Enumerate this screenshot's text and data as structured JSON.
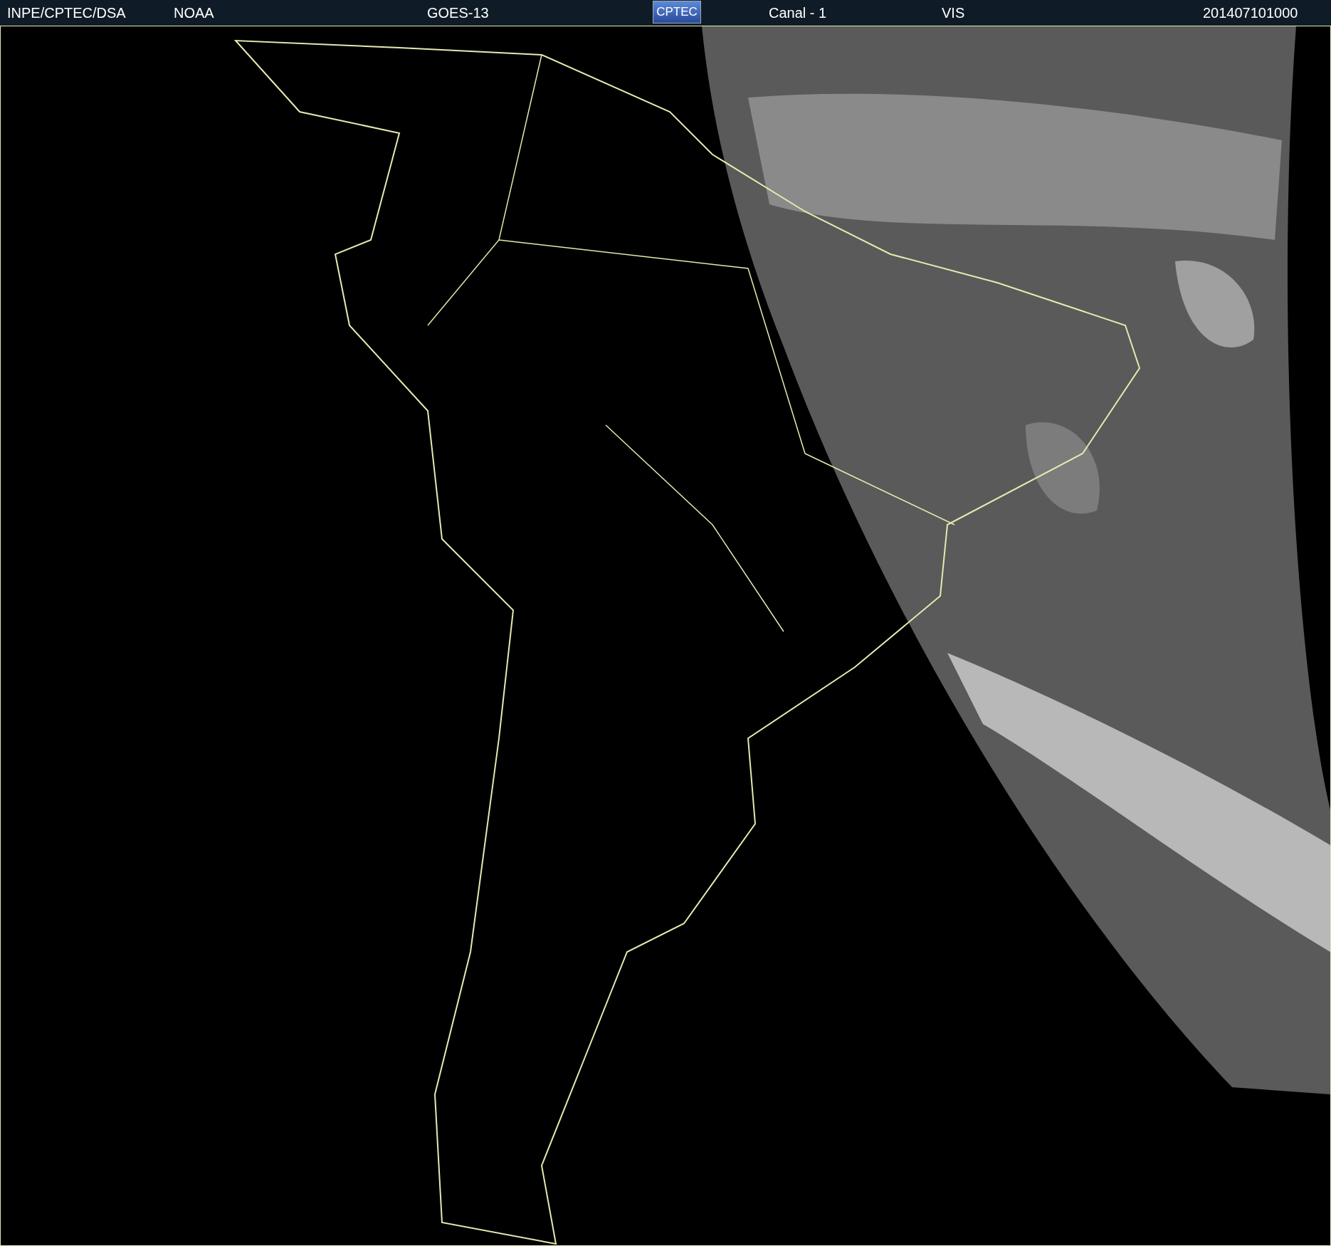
{
  "header": {
    "items": [
      {
        "kind": "text",
        "text": "INPE/CPTEC/DSA"
      },
      {
        "kind": "text",
        "text": "NOAA"
      },
      {
        "kind": "text",
        "text": "GOES-13"
      },
      {
        "kind": "logo",
        "text": "CPTEC"
      },
      {
        "kind": "text",
        "text": "Canal - 1"
      },
      {
        "kind": "text",
        "text": "VIS"
      },
      {
        "kind": "text",
        "text": "201407101000"
      }
    ]
  }
}
